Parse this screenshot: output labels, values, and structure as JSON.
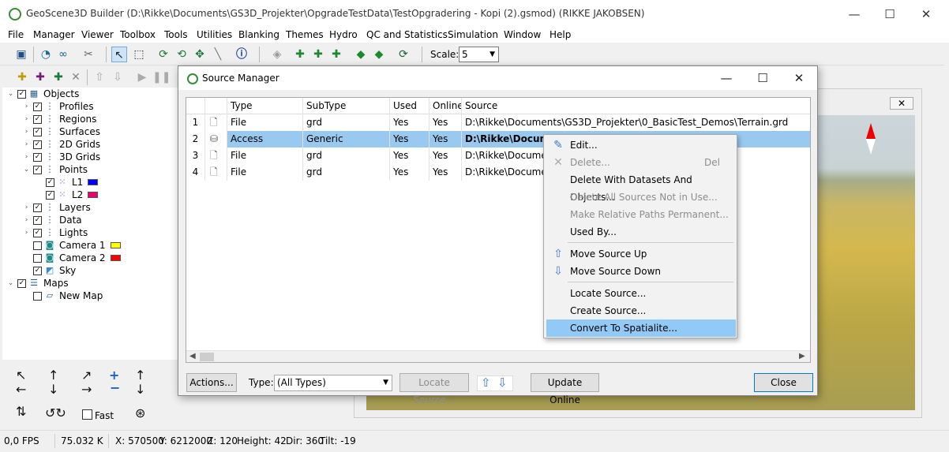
{
  "window": {
    "title": "GeoScene3D Builder (D:\\Rikke\\Documents\\GS3D_Projekter\\OpgradeTestData\\TestOpgradering - Kopi (2).gsmod) (RIKKE JAKOBSEN)",
    "minimize": "—",
    "maximize": "☐",
    "close": "✕"
  },
  "menu": [
    "File",
    "Manager",
    "Viewer",
    "Toolbox",
    "Tools",
    "Utilities",
    "Blanking",
    "Themes",
    "Hydro",
    "QC and Statistics",
    "Simulation",
    "Window",
    "Help"
  ],
  "toolbar": {
    "scale_label": "Scale:",
    "scale_value": "5"
  },
  "tree": {
    "objects": "Objects",
    "profiles": "Profiles",
    "regions": "Regions",
    "surfaces": "Surfaces",
    "grids2d": "2D Grids",
    "grids3d": "3D Grids",
    "points": "Points",
    "l1": "L1",
    "l2": "L2",
    "layers": "Layers",
    "data": "Data",
    "lights": "Lights",
    "camera1": "Camera 1",
    "camera2": "Camera 2",
    "sky": "Sky",
    "maps": "Maps",
    "newmap": "New Map"
  },
  "colors": {
    "l1": "#0000ff",
    "l2": "#e8006e",
    "camera1": "#ffff00",
    "camera2": "#ff0000",
    "selection": "#99c9ef",
    "menu_highlight": "#91c9f7"
  },
  "nav": {
    "fast_label": "Fast"
  },
  "status": {
    "fps": "0,0 FPS",
    "mem": "75.032 K",
    "x": "X: 570500",
    "y": "Y: 6212000",
    "z": "Z: 120",
    "height": "Height: 42",
    "dir": "Dir: 360",
    "tilt": "Tilt: -19"
  },
  "view": {
    "close": "✕"
  },
  "dialog": {
    "title": "Source Manager",
    "columns": [
      "",
      "",
      "Type",
      "SubType",
      "Used",
      "Online",
      "Source"
    ],
    "rows": [
      {
        "n": "1",
        "type": "File",
        "subtype": "grd",
        "used": "Yes",
        "online": "Yes",
        "source": "D:\\Rikke\\Documents\\GS3D_Projekter\\0_BasicTest_Demos\\Terrain.grd"
      },
      {
        "n": "2",
        "type": "Access",
        "subtype": "Generic",
        "used": "Yes",
        "online": "Yes",
        "source": "D:\\Rikke\\Documents"
      },
      {
        "n": "3",
        "type": "File",
        "subtype": "grd",
        "used": "Yes",
        "online": "Yes",
        "source": "D:\\Rikke\\Documents"
      },
      {
        "n": "4",
        "type": "File",
        "subtype": "grd",
        "used": "Yes",
        "online": "Yes",
        "source": "D:\\Rikke\\Documents"
      }
    ],
    "actions_btn": "Actions...",
    "type_label": "Type:",
    "type_value": "(All Types)",
    "locate_btn": "Locate Source...",
    "update_btn": "Update Online",
    "close_btn": "Close"
  },
  "context_menu": {
    "edit": "Edit...",
    "delete": "Delete...",
    "delete_short": "Del",
    "delete_with": "Delete With Datasets And Objects...",
    "delete_all": "Delete All Sources Not in Use...",
    "make_relative": "Make Relative Paths Permanent...",
    "used_by": "Used By...",
    "move_up": "Move Source Up",
    "move_down": "Move Source Down",
    "locate": "Locate Source...",
    "create": "Create Source...",
    "convert": "Convert To Spatialite..."
  }
}
